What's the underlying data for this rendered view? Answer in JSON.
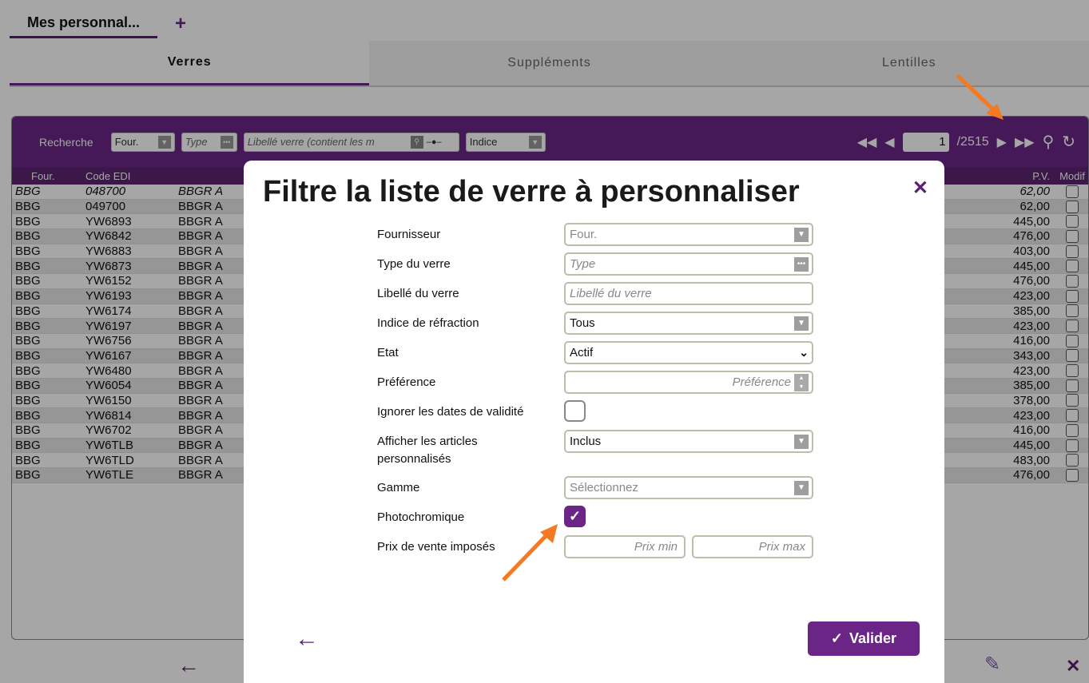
{
  "tabs": {
    "main_tab": "Mes personnal...",
    "add_tab": "+"
  },
  "subtabs": {
    "verres": "Verres",
    "supplements": "Suppléments",
    "lentilles": "Lentilles"
  },
  "toolbar": {
    "search_label": "Recherche",
    "four_filter": "Four.",
    "type_filter": "Type",
    "libelle_filter": "Libellé verre (contient les m",
    "indice_filter": "Indice",
    "page_current": "1",
    "page_total": "/2515"
  },
  "list": {
    "headers": {
      "four": "Four.",
      "code": "Code EDI",
      "pv": "P.V.",
      "modif": "Modif"
    },
    "rows": [
      {
        "four": "BBG",
        "code": "048700",
        "lib": "BBGR A",
        "pv": "62,00"
      },
      {
        "four": "BBG",
        "code": "049700",
        "lib": "BBGR A",
        "pv": "62,00"
      },
      {
        "four": "BBG",
        "code": "YW6893",
        "lib": "BBGR A",
        "pv": "445,00"
      },
      {
        "four": "BBG",
        "code": "YW6842",
        "lib": "BBGR A",
        "pv": "476,00"
      },
      {
        "four": "BBG",
        "code": "YW6883",
        "lib": "BBGR A",
        "pv": "403,00"
      },
      {
        "four": "BBG",
        "code": "YW6873",
        "lib": "BBGR A",
        "pv": "445,00"
      },
      {
        "four": "BBG",
        "code": "YW6152",
        "lib": "BBGR A",
        "pv": "476,00"
      },
      {
        "four": "BBG",
        "code": "YW6193",
        "lib": "BBGR A",
        "pv": "423,00"
      },
      {
        "four": "BBG",
        "code": "YW6174",
        "lib": "BBGR A",
        "pv": "385,00"
      },
      {
        "four": "BBG",
        "code": "YW6197",
        "lib": "BBGR A",
        "pv": "423,00"
      },
      {
        "four": "BBG",
        "code": "YW6756",
        "lib": "BBGR A",
        "pv": "416,00"
      },
      {
        "four": "BBG",
        "code": "YW6167",
        "lib": "BBGR A",
        "pv": "343,00"
      },
      {
        "four": "BBG",
        "code": "YW6480",
        "lib": "BBGR A",
        "pv": "423,00"
      },
      {
        "four": "BBG",
        "code": "YW6054",
        "lib": "BBGR A",
        "pv": "385,00"
      },
      {
        "four": "BBG",
        "code": "YW6150",
        "lib": "BBGR A",
        "pv": "378,00"
      },
      {
        "four": "BBG",
        "code": "YW6814",
        "lib": "BBGR A",
        "pv": "423,00"
      },
      {
        "four": "BBG",
        "code": "YW6702",
        "lib": "BBGR A",
        "pv": "416,00"
      },
      {
        "four": "BBG",
        "code": "YW6TLB",
        "lib": "BBGR A",
        "pv": "445,00"
      },
      {
        "four": "BBG",
        "code": "YW6TLD",
        "lib": "BBGR A",
        "pv": "483,00"
      },
      {
        "four": "BBG",
        "code": "YW6TLE",
        "lib": "BBGR A",
        "pv": "476,00"
      }
    ]
  },
  "modal": {
    "title": "Filtre la liste de verre à personnaliser",
    "fields": {
      "fournisseur": {
        "label": "Fournisseur",
        "value": "Four."
      },
      "type": {
        "label": "Type du verre",
        "placeholder": "Type"
      },
      "libelle": {
        "label": "Libellé du verre",
        "placeholder": "Libellé du verre"
      },
      "indice": {
        "label": "Indice de réfraction",
        "value": "Tous"
      },
      "etat": {
        "label": "Etat",
        "value": "Actif"
      },
      "preference": {
        "label": "Préférence",
        "placeholder": "Préférence"
      },
      "ignorer": {
        "label": "Ignorer les dates de validité",
        "checked": false
      },
      "afficher": {
        "label": "Afficher les articles personnalisés",
        "value": "Inclus"
      },
      "gamme": {
        "label": "Gamme",
        "placeholder": "Sélectionnez"
      },
      "photochromique": {
        "label": "Photochromique",
        "checked": true
      },
      "prix": {
        "label": "Prix de vente imposés",
        "min_placeholder": "Prix min",
        "max_placeholder": "Prix max"
      }
    },
    "valider": "Valider"
  },
  "colors": {
    "accent": "#6a2586",
    "annotation_arrow": "#f47920"
  },
  "icons": [
    "plus-icon",
    "first-page-icon",
    "prev-page-icon",
    "next-page-icon",
    "last-page-icon",
    "search-icon",
    "refresh-icon",
    "close-icon",
    "back-arrow-icon",
    "check-icon",
    "edit-icon"
  ]
}
